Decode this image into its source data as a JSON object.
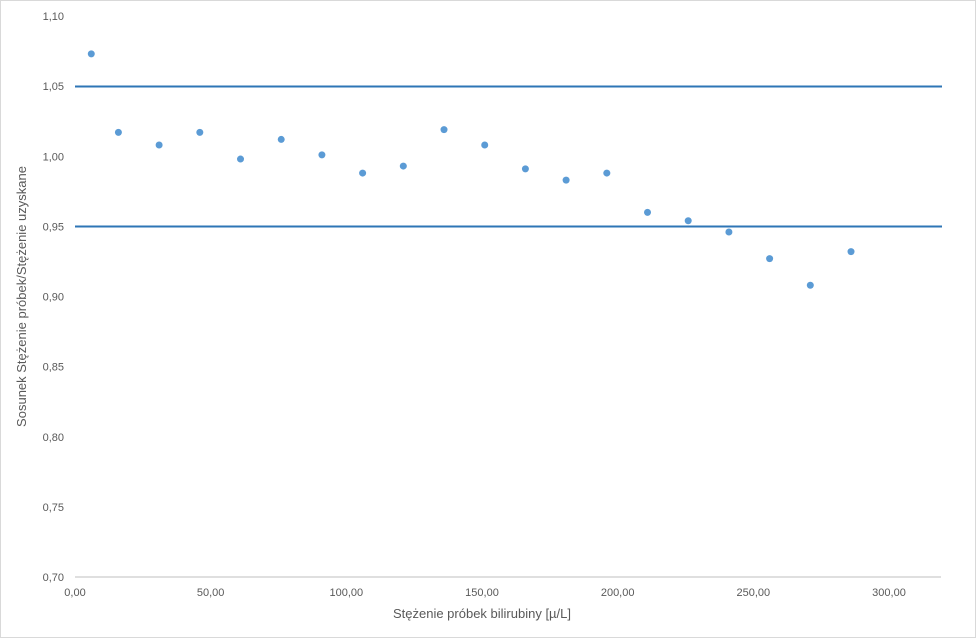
{
  "chart_data": {
    "type": "scatter",
    "title": "",
    "xlabel": "Stężenie próbek bilirubiny [µ/L]",
    "ylabel": "Sosunek Stężenie próbek/Stężenie uzyskane",
    "xlim": [
      0,
      300
    ],
    "ylim": [
      0.7,
      1.1
    ],
    "x_ticks": [
      "0,00",
      "50,00",
      "100,00",
      "150,00",
      "200,00",
      "250,00",
      "300,00"
    ],
    "y_ticks": [
      "0,70",
      "0,75",
      "0,80",
      "0,85",
      "0,90",
      "0,95",
      "1,00",
      "1,05",
      "1,10"
    ],
    "grid": false,
    "legend": "none",
    "points": [
      {
        "x": 6,
        "y": 1.073
      },
      {
        "x": 16,
        "y": 1.017
      },
      {
        "x": 31,
        "y": 1.008
      },
      {
        "x": 46,
        "y": 1.017
      },
      {
        "x": 61,
        "y": 0.998
      },
      {
        "x": 76,
        "y": 1.012
      },
      {
        "x": 91,
        "y": 1.001
      },
      {
        "x": 106,
        "y": 0.988
      },
      {
        "x": 121,
        "y": 0.993
      },
      {
        "x": 136,
        "y": 1.019
      },
      {
        "x": 151,
        "y": 1.008
      },
      {
        "x": 166,
        "y": 0.991
      },
      {
        "x": 181,
        "y": 0.983
      },
      {
        "x": 196,
        "y": 0.988
      },
      {
        "x": 211,
        "y": 0.96
      },
      {
        "x": 226,
        "y": 0.954
      },
      {
        "x": 241,
        "y": 0.946
      },
      {
        "x": 256,
        "y": 0.927
      },
      {
        "x": 271,
        "y": 0.908
      },
      {
        "x": 286,
        "y": 0.932
      }
    ],
    "reference_lines": [
      1.05,
      0.95
    ],
    "colors": {
      "points": "#5b9bd5",
      "lines": "#2e75b6",
      "axis": "#bfbfbf",
      "text": "#595959"
    }
  }
}
